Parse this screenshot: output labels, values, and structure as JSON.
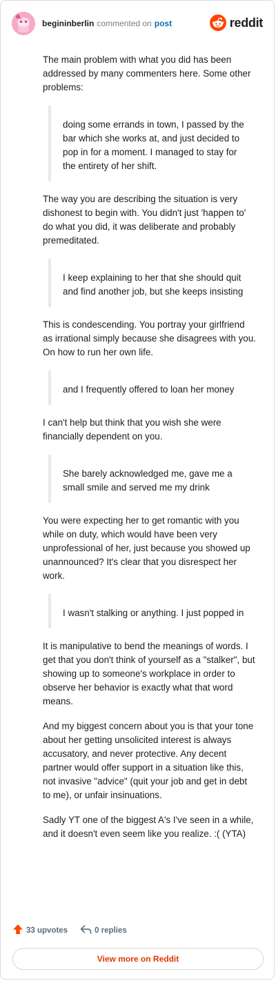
{
  "header": {
    "username": "begininberlin",
    "action": "commented on",
    "post_link": "post",
    "brand": "reddit"
  },
  "comment": {
    "blocks": [
      {
        "type": "p",
        "text": "The main problem with what you did has been addressed by many commenters here. Some other problems:"
      },
      {
        "type": "quote",
        "text": "doing some errands in town, I passed by the bar which she works at, and just decided to pop in for a moment. I managed to stay for the entirety of her shift."
      },
      {
        "type": "p",
        "text": "The way you are describing the situation is very dishonest to begin with. You didn't just 'happen to' do what you did, it was deliberate and probably premeditated."
      },
      {
        "type": "quote",
        "text": "I keep explaining to her that she should quit and find another job, but she keeps insisting"
      },
      {
        "type": "p",
        "text": "This is condescending. You portray your girlfriend as irrational simply because she disagrees with you. On how to run her own life."
      },
      {
        "type": "quote",
        "text": "and I frequently offered to loan her money"
      },
      {
        "type": "p",
        "text": "I can't help but think that you wish she were financially dependent on you."
      },
      {
        "type": "quote",
        "text": "She barely acknowledged me, gave me a small smile and served me my drink"
      },
      {
        "type": "p",
        "text": "You were expecting her to get romantic with you while on duty, which would have been very unprofessional of her, just because you showed up unannounced? It's clear that you disrespect her work."
      },
      {
        "type": "quote",
        "text": "I wasn't stalking or anything. I just popped in"
      },
      {
        "type": "p",
        "text": "It is manipulative to bend the meanings of words. I get that you don't think of yourself as a \"stalker\", but showing up to someone's workplace in order to observe her behavior is exactly what that word means."
      },
      {
        "type": "p",
        "text": "And my biggest concern about you is that your tone about her getting unsolicited interest is always accusatory, and never protective. Any decent partner would offer support in a situation like this, not invasive \"advice\" (quit your job and get in debt to me), or unfair insinuations."
      },
      {
        "type": "p",
        "text": "Sadly YT one of the biggest A's I've seen in a while, and it doesn't even seem like you realize. :( (YTA)"
      }
    ]
  },
  "footer": {
    "upvotes": "33 upvotes",
    "replies": "0 replies",
    "view_more": "View more on Reddit"
  },
  "colors": {
    "brand_orange": "#ff4500",
    "link_blue": "#0a6bb5",
    "view_more_red": "#d93a00",
    "upvote_arrow": "#ff4500"
  },
  "icons": {
    "avatar": "snoo-avatar-icon",
    "brand": "reddit-logo-icon",
    "upvote": "upvote-arrow-icon",
    "reply": "reply-icon"
  }
}
